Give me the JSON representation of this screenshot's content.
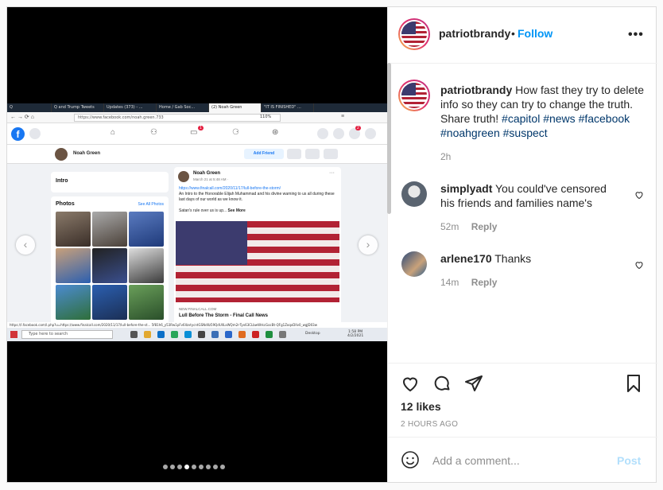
{
  "post": {
    "username": "patriotbrandy",
    "follow_label": "Follow",
    "more_label": "•••",
    "caption_text": "How fast they try to delete info so they can try to change the truth. Share truth!",
    "hashtags": [
      "#capitol",
      "#news",
      "#facebook",
      "#noahgreen",
      "#suspect"
    ],
    "caption_time": "2h",
    "likes": "12 likes",
    "posted_ago": "2 HOURS AGO",
    "comment_placeholder": "Add a comment...",
    "post_label": "Post"
  },
  "comments": [
    {
      "user": "simplyadt",
      "text": "You could've censored his friends and families name's",
      "time": "52m",
      "reply": "Reply"
    },
    {
      "user": "arlene170",
      "text": "Thanks",
      "time": "14m",
      "reply": "Reply"
    }
  ],
  "carousel": {
    "count": 9,
    "active_index": 3
  },
  "screenshot": {
    "tabs": [
      "Q",
      "Q and Trump Tweets",
      "Updates (373) - ...",
      "Home / Gab Soc...",
      "(2) Noah Green",
      "\"IT IS FINISHED\" ..."
    ],
    "url": "https://www.facebook.com/noah.green.733",
    "zoom": "110%",
    "notification_count": "1",
    "message_count": "2",
    "profile_name": "Noah Green",
    "add_friend": "Add Friend",
    "intro_label": "Intro",
    "photos_label": "Photos",
    "see_all_photos": "See All Photos",
    "post_author": "Noah Green",
    "post_date": "March 21 at 5:48 AM · ",
    "post_link": "https://www.finalcall.com/2020/11/17/lull-before-the-storm/",
    "post_text": "An Intro to the Honorable Elijah Muhammad and his divine warning to us all during these last days of our world as we know it.",
    "post_text2": "Satan's rule over us is up...",
    "see_more": "See More",
    "link_source": "NEW.FINALCALL.COM",
    "link_title": "Lull Before The Storm - Final Call News",
    "status_url": "https://l.facebook.com/l.php?u=https://www.finalcall.com/2020/11/17/lull-before-the-st... 5f81h6_y53Rw1pFv6llzvtycntGSNdIlz59QdUllLxWQm2r-Tyx63CLbwWrkcGocBt-QFg1ZoqxDlIv0_wgJD03w",
    "taskbar_search": "Type here to search",
    "taskbar_desktop": "Desktop",
    "taskbar_time": "1:58 PM",
    "taskbar_date": "4/2/2021"
  },
  "colors": {
    "link_blue": "#0095f6",
    "hashtag": "#00376b",
    "fb_blue": "#1877f2"
  }
}
